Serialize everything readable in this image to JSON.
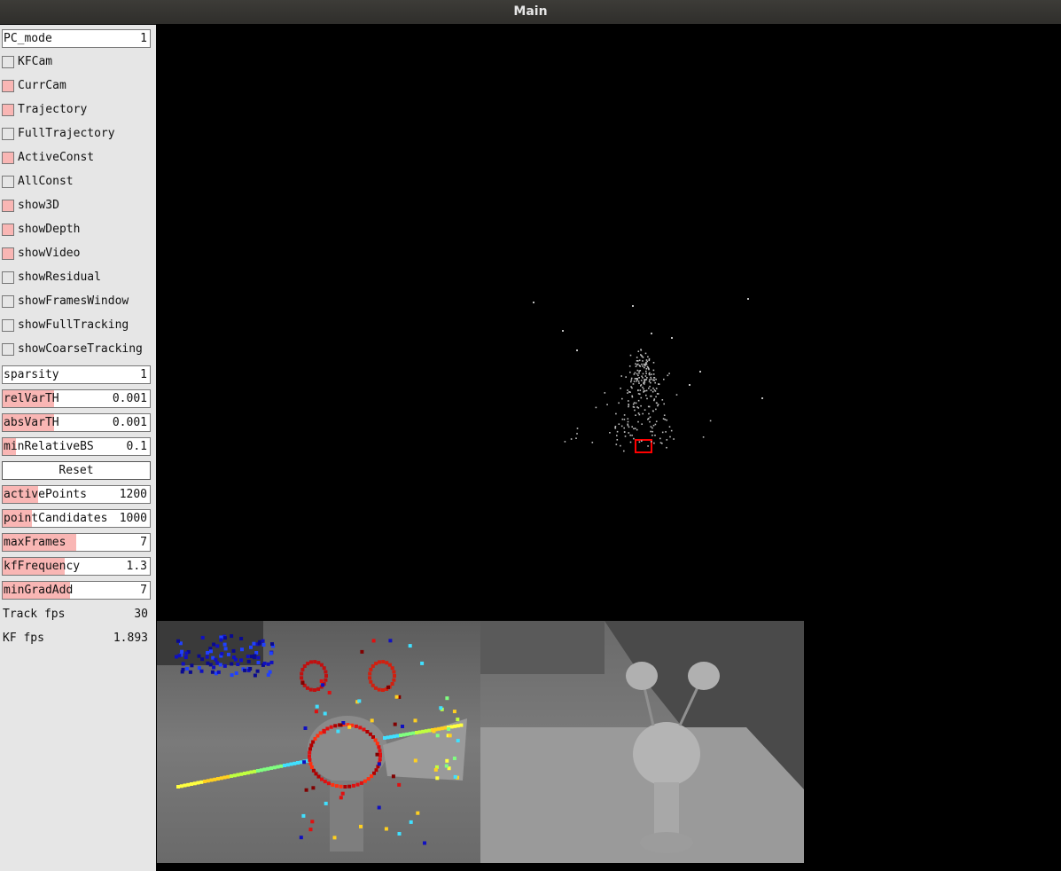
{
  "window": {
    "title": "Main"
  },
  "panel": {
    "pc_mode": {
      "label": "PC_mode",
      "value": "1"
    },
    "checkboxes": [
      {
        "label": "KFCam",
        "checked": false
      },
      {
        "label": "CurrCam",
        "checked": true
      },
      {
        "label": "Trajectory",
        "checked": true
      },
      {
        "label": "FullTrajectory",
        "checked": false
      },
      {
        "label": "ActiveConst",
        "checked": true
      },
      {
        "label": "AllConst",
        "checked": false
      },
      {
        "label": "show3D",
        "checked": true
      },
      {
        "label": "showDepth",
        "checked": true
      },
      {
        "label": "showVideo",
        "checked": true
      },
      {
        "label": "showResidual",
        "checked": false
      },
      {
        "label": "showFramesWindow",
        "checked": false
      },
      {
        "label": "showFullTracking",
        "checked": false
      },
      {
        "label": "showCoarseTracking",
        "checked": false
      }
    ],
    "sparsity": {
      "label": "sparsity",
      "value": "1"
    },
    "rel_var_th": {
      "label": "relVarTH",
      "value": "0.001",
      "fill": 0.35
    },
    "abs_var_th": {
      "label": "absVarTH",
      "value": "0.001",
      "fill": 0.35
    },
    "min_relative_bs": {
      "label": "minRelativeBS",
      "value": "0.1",
      "fill": 0.09
    },
    "reset_label": "Reset",
    "active_points": {
      "label": "activePoints",
      "value": "1200",
      "fill": 0.24
    },
    "point_candidates": {
      "label": "pointCandidates",
      "value": "1000",
      "fill": 0.2
    },
    "max_frames": {
      "label": "maxFrames",
      "value": "7",
      "fill": 0.5
    },
    "kf_frequency": {
      "label": "kfFrequency",
      "value": "1.3",
      "fill": 0.42
    },
    "min_grad_add": {
      "label": "minGradAdd",
      "value": "7",
      "fill": 0.46
    },
    "track_fps": {
      "label": "Track fps",
      "value": "30"
    },
    "kf_fps": {
      "label": "KF fps",
      "value": "1.893"
    }
  },
  "colors": {
    "slider_fill": "#f9b6b4",
    "camera_box": "#ff0000",
    "point_cloud": "#bdbdbd"
  }
}
